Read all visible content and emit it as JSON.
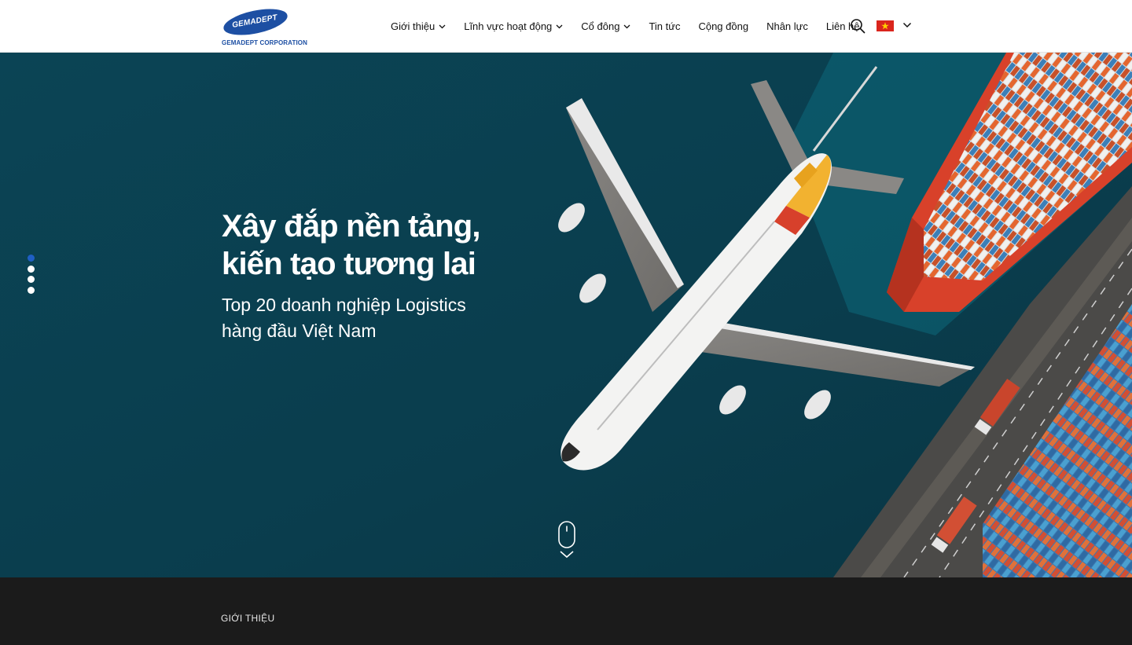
{
  "header": {
    "logo": {
      "brand": "GEMADEPT",
      "corporation": "GEMADEPT CORPORATION",
      "icon": "gemadept-logo"
    },
    "nav": [
      {
        "label": "Giới thiệu",
        "has_dropdown": true
      },
      {
        "label": "Lĩnh vực hoạt động",
        "has_dropdown": true
      },
      {
        "label": "Cổ đông",
        "has_dropdown": true
      },
      {
        "label": "Tin tức",
        "has_dropdown": false
      },
      {
        "label": "Cộng đồng",
        "has_dropdown": false
      },
      {
        "label": "Nhân lực",
        "has_dropdown": false
      },
      {
        "label": "Liên hệ",
        "has_dropdown": false
      }
    ],
    "search_icon": "search-icon",
    "language": {
      "flag": "vietnam-flag-icon",
      "dropdown_icon": "chevron-down-icon"
    }
  },
  "hero": {
    "title_line1": "Xây đắp nền tảng,",
    "title_line2": "kiến tạo tương lai",
    "subtitle_line1": "Top 20 doanh nghiệp Logistics",
    "subtitle_line2": "hàng đầu Việt Nam",
    "slides_total": 4,
    "active_slide": 1,
    "scroll_icon": "mouse-scroll-icon"
  },
  "intro": {
    "label": "GIỚI THIỆU"
  },
  "colors": {
    "brand_blue": "#1d4fa3",
    "active_dot": "#1f5fc4",
    "hero_sea": "#0a3e4f",
    "dark_section": "#1b1b1b"
  }
}
